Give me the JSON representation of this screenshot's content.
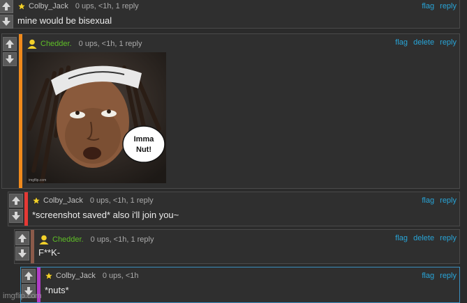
{
  "comments": [
    {
      "username": "Colby_Jack",
      "meta": "0 ups, <1h, 1 reply",
      "text": "mine would be bisexual",
      "actions": [
        "flag",
        "reply"
      ]
    },
    {
      "username": "Chedder.",
      "meta": "0 ups, <1h, 1 reply",
      "actions": [
        "flag",
        "delete",
        "reply"
      ],
      "image": {
        "caption": "Imma Nut!",
        "watermark": "imgflip.com"
      }
    },
    {
      "username": "Colby_Jack",
      "meta": "0 ups, <1h, 1 reply",
      "text": "*screenshot saved* also i'll join you~",
      "actions": [
        "flag",
        "reply"
      ]
    },
    {
      "username": "Chedder.",
      "meta": "0 ups, <1h, 1 reply",
      "text": "F**K-",
      "actions": [
        "flag",
        "delete",
        "reply"
      ]
    },
    {
      "username": "Colby_Jack",
      "meta": "0 ups, <1h",
      "text": "*nuts*",
      "actions": [
        "flag",
        "reply"
      ]
    }
  ],
  "site_watermark": "imgflip.com",
  "colors": {
    "link": "#28a5d8",
    "chedder_name": "#5fbf27",
    "bar_orange": "#f08a1c",
    "bar_red": "#e53935",
    "bar_brown": "#8b5a4a",
    "bar_purple": "#b03cc6"
  }
}
